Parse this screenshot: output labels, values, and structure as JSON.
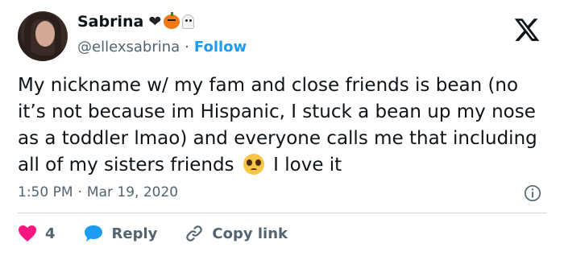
{
  "author": {
    "display_name": "Sabrina",
    "handle": "@ellexsabrina",
    "separator": "·",
    "follow_label": "Follow",
    "name_emojis": [
      "black-heart-icon",
      "jack-o-lantern-icon",
      "ghost-icon"
    ]
  },
  "tweet": {
    "text_part1": "My nickname w/ my fam and close friends is bean (no it’s not because im Hispanic, I stuck a bean up my nose as a toddler lmao) and everyone calls me that including all of my sisters friends",
    "text_part2": "I love it",
    "inline_emoji": "pleading-face-icon",
    "time": "1:50 PM",
    "separator": "·",
    "date": "Mar 19, 2020"
  },
  "actions": {
    "like_count": "4",
    "reply_label": "Reply",
    "copy_link_label": "Copy link"
  },
  "colors": {
    "accent": "#1d9bf0",
    "like": "#f91880",
    "muted": "#536471",
    "text": "#0f1419",
    "divider": "#cfd9de"
  }
}
